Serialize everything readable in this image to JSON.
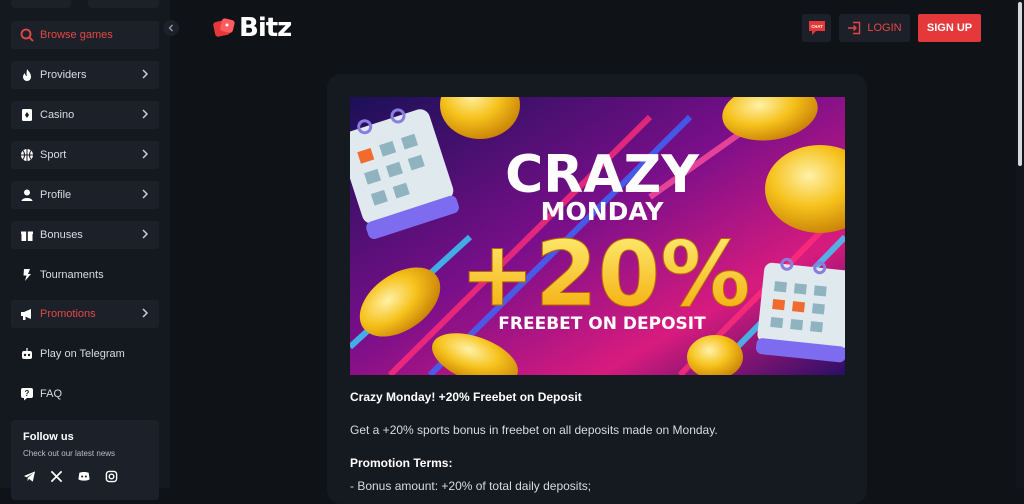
{
  "brand": {
    "name": "Bitz"
  },
  "header": {
    "login_label": "LOGIN",
    "signup_label": "SIGN UP",
    "chat_label": "CHAT"
  },
  "sidebar": {
    "search_label": "Browse games",
    "items": [
      {
        "label": "Providers",
        "icon": "fire-icon"
      },
      {
        "label": "Casino",
        "icon": "cards-icon"
      },
      {
        "label": "Sport",
        "icon": "ball-icon"
      },
      {
        "label": "Profile",
        "icon": "user-icon"
      },
      {
        "label": "Bonuses",
        "icon": "gift-icon"
      },
      {
        "label": "Tournaments",
        "icon": "bolt-icon"
      },
      {
        "label": "Promotions",
        "icon": "megaphone-icon"
      },
      {
        "label": "Play on Telegram",
        "icon": "robot-icon"
      },
      {
        "label": "FAQ",
        "icon": "help-icon"
      }
    ],
    "follow_title": "Follow us",
    "follow_subtitle": "Check out our latest news",
    "socials": [
      "telegram-icon",
      "x-icon",
      "discord-icon",
      "instagram-icon"
    ]
  },
  "banner": {
    "line1": "CRAZY",
    "line2": "MONDAY",
    "line3": "+20%",
    "line4": "FREEBET ON DEPOSIT"
  },
  "promo": {
    "title": "Crazy Monday! +20% Freebet on Deposit",
    "description": "Get a +20% sports bonus in freebet on all deposits made on Monday.",
    "terms_title": "Promotion Terms:",
    "terms_line1": "- Bonus amount: +20% of total daily deposits;"
  },
  "colors": {
    "accent": "#e5383b",
    "background": "#0f1217",
    "panel": "#1c2129"
  }
}
